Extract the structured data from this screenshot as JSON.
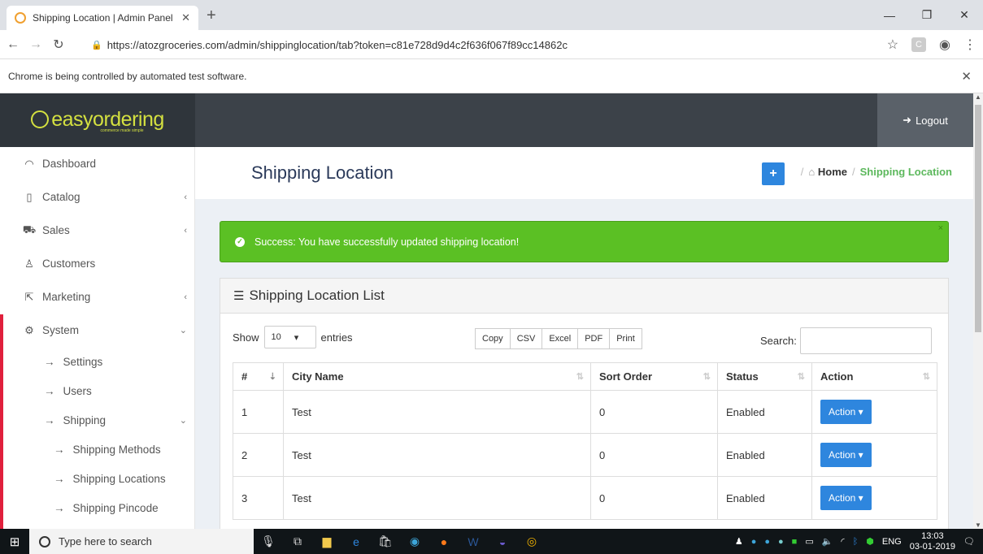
{
  "browser": {
    "tab_title": "Shipping Location | Admin Panel",
    "url": "https://atozgroceries.com/admin/shippinglocation/tab?token=c81e728d9d4c2f636f067f89cc14862c",
    "infobar": "Chrome is being controlled by automated test software."
  },
  "header": {
    "brand": "easyordering",
    "tagline": "commerce made simple",
    "logout_label": "Logout"
  },
  "sidebar": {
    "items": [
      {
        "label": "Dashboard"
      },
      {
        "label": "Catalog"
      },
      {
        "label": "Sales"
      },
      {
        "label": "Customers"
      },
      {
        "label": "Marketing"
      },
      {
        "label": "System"
      }
    ],
    "system_sub": [
      "Settings",
      "Users",
      "Shipping"
    ],
    "shipping_sub": [
      "Shipping Methods",
      "Shipping Locations",
      "Shipping Pincode"
    ]
  },
  "content": {
    "title": "Shipping Location",
    "breadcrumb_home": "Home",
    "breadcrumb_current": "Shipping Location",
    "alert": "Success: You have successfully updated shipping location!",
    "panel_title": "Shipping Location List",
    "show_label": "Show",
    "entries_value": "10",
    "entries_label": "entries",
    "export_buttons": [
      "Copy",
      "CSV",
      "Excel",
      "PDF",
      "Print"
    ],
    "search_label": "Search:",
    "columns": [
      "#",
      "City Name",
      "Sort Order",
      "Status",
      "Action"
    ],
    "rows": [
      {
        "num": "1",
        "city": "Test",
        "sort": "0",
        "status": "Enabled",
        "action": "Action ▾"
      },
      {
        "num": "2",
        "city": "Test",
        "sort": "0",
        "status": "Enabled",
        "action": "Action ▾"
      },
      {
        "num": "3",
        "city": "Test",
        "sort": "0",
        "status": "Enabled",
        "action": "Action ▾"
      }
    ]
  },
  "taskbar": {
    "search_placeholder": "Type here to search",
    "lang": "ENG",
    "time": "13:03",
    "date": "03-01-2019"
  },
  "colors": {
    "accent": "#2e86de",
    "success": "#5bc024",
    "brand": "#d4e040",
    "topbar": "#3c4249",
    "active_marker": "#e0203c"
  }
}
